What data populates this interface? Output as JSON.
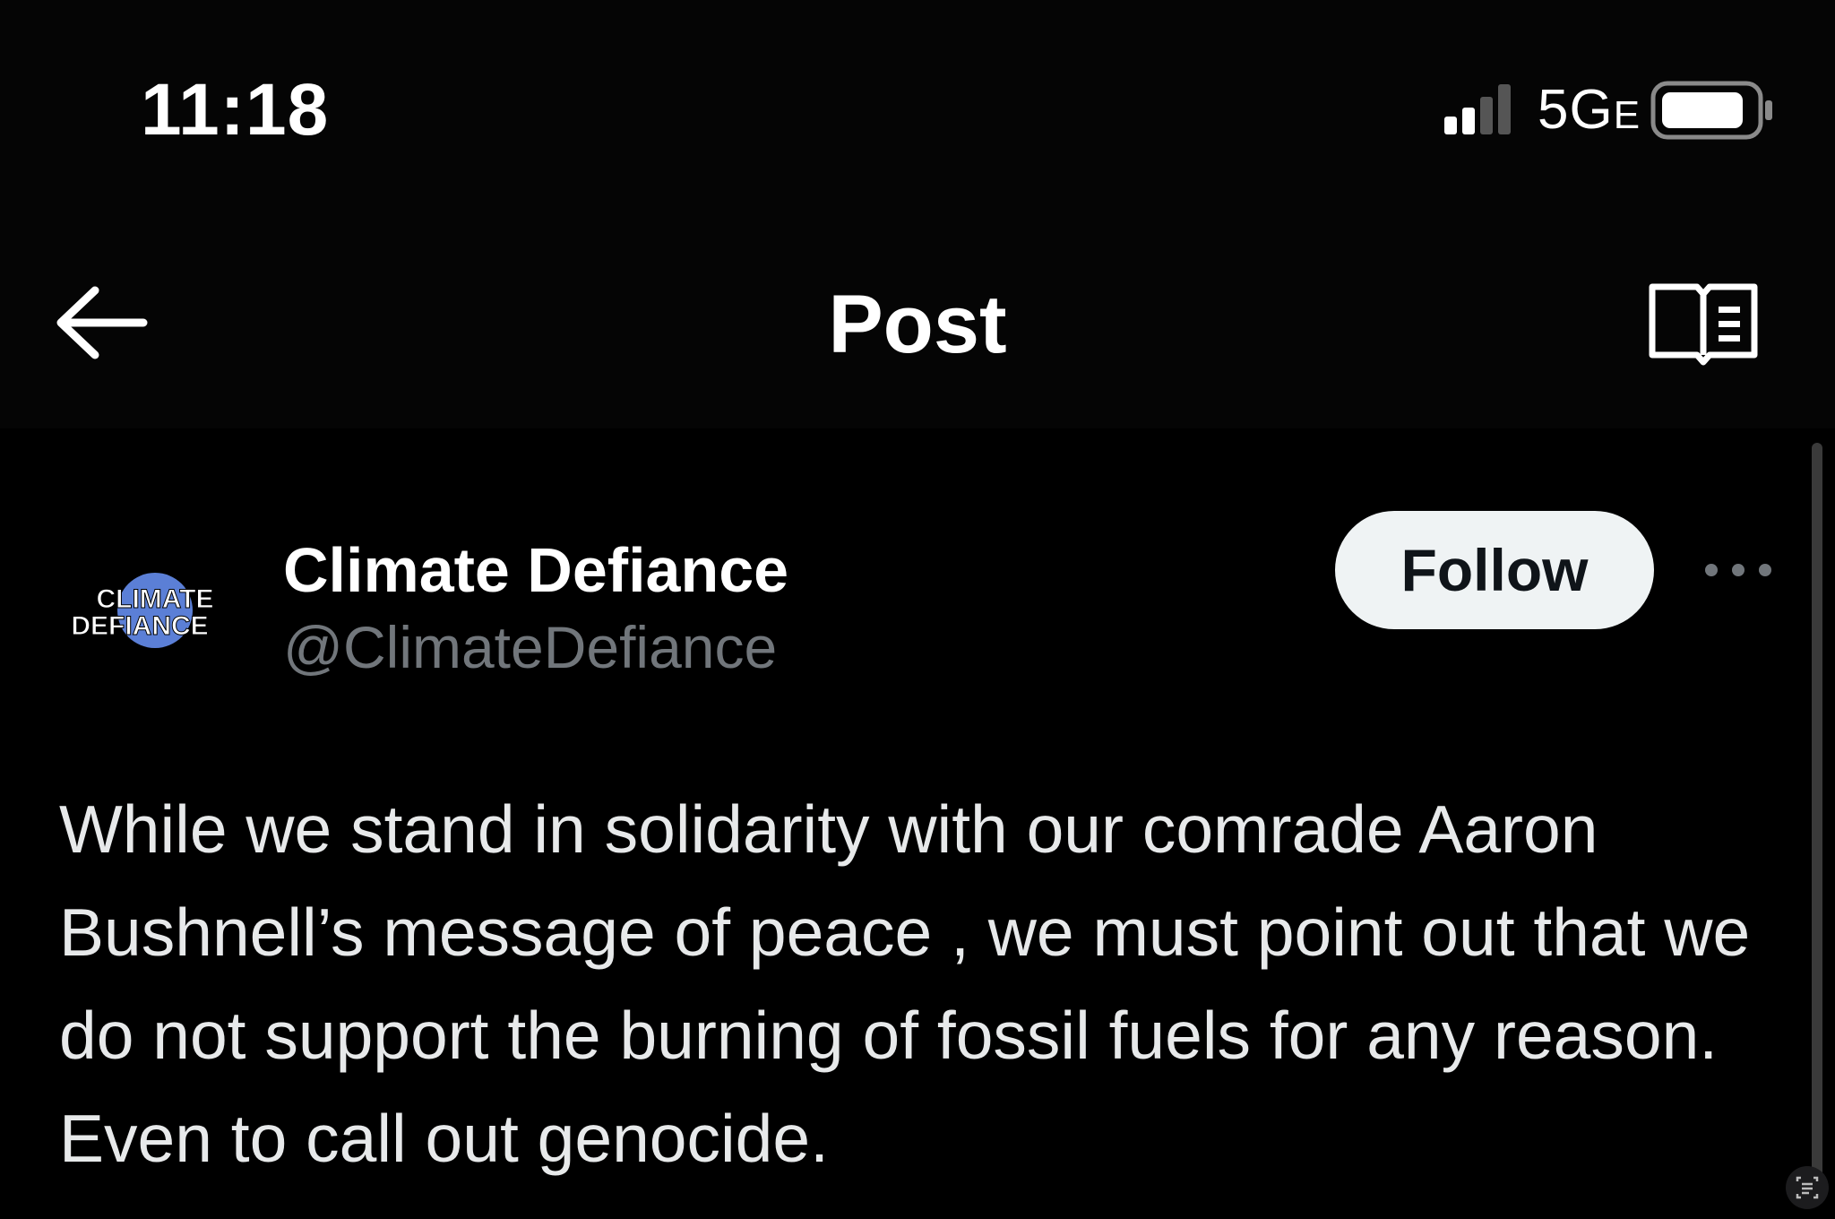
{
  "status_bar": {
    "time": "11:18",
    "network": "5G",
    "network_suffix": "E",
    "icons": [
      "signal-icon",
      "battery-icon"
    ]
  },
  "nav": {
    "title": "Post",
    "icons": [
      "back-arrow-icon",
      "reader-view-icon"
    ]
  },
  "post": {
    "author_name": "Climate Defiance",
    "author_handle": "@ClimateDefiance",
    "avatar_text_line1": "CLIMATE",
    "avatar_text_line2": "DEFIANCE",
    "follow_label": "Follow",
    "text": "While we stand in solidarity with our comrade Aaron Bushnell’s message of peace , we must point out that we do not support the burning of fossil fuels for any reason. Even to call out genocide."
  },
  "colors": {
    "background": "#000000",
    "primary_text": "#e7e9ea",
    "secondary_text": "#71767b",
    "follow_button_bg": "#eff3f4",
    "follow_button_text": "#0f1419",
    "avatar_globe": "#5b7fd6"
  }
}
